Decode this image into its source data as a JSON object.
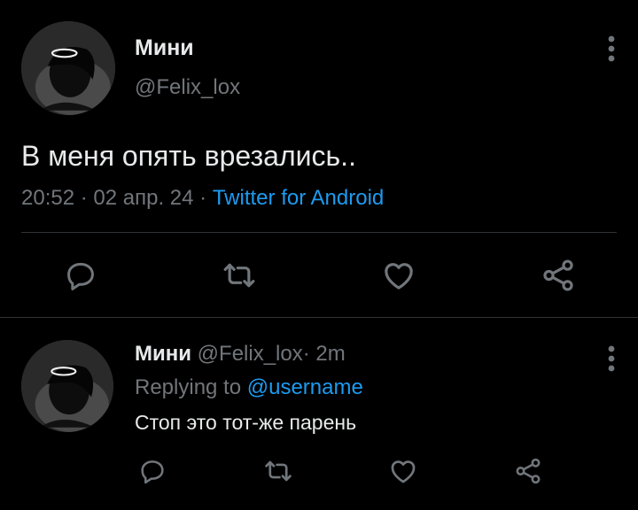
{
  "tweet": {
    "author_name": "Мини",
    "author_handle": "@Felix_lox",
    "text": "В меня опять врезались..",
    "time": "20:52",
    "date": "02 апр. 24",
    "separator": "·",
    "source": "Twitter for Android",
    "more_icon": "more-vertical-icon",
    "actions": {
      "reply_icon": "reply-icon",
      "retweet_icon": "retweet-icon",
      "like_icon": "like-icon",
      "share_icon": "share-icon"
    }
  },
  "reply": {
    "author_name": "Мини",
    "author_handle": "@Felix_lox",
    "separator": "·",
    "time": "2m",
    "replying_to_label": "Replying to",
    "replying_to_mention": "@username",
    "text": "Стоп это тот-же парень",
    "more_icon": "more-vertical-icon",
    "actions": {
      "reply_icon": "reply-icon",
      "retweet_icon": "retweet-icon",
      "like_icon": "like-icon",
      "share_icon": "share-icon"
    }
  },
  "colors": {
    "background": "#000000",
    "primary_text": "#e7e9ea",
    "secondary_text": "#71767b",
    "accent": "#1d9bf0",
    "divider": "#2f3336"
  }
}
